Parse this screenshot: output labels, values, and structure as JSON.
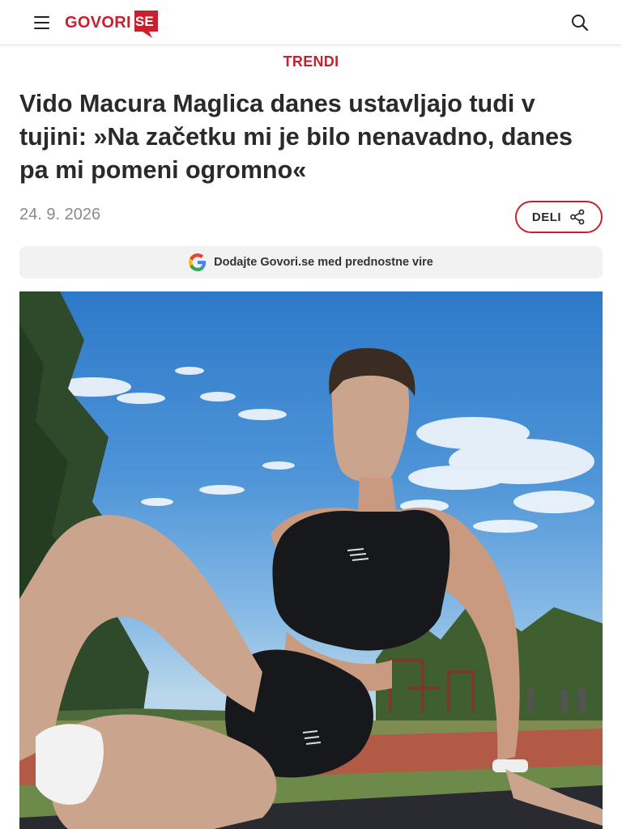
{
  "header": {
    "logo_text": "GOVORI",
    "logo_badge": "SE"
  },
  "article": {
    "category": "TRENDI",
    "title": "Vido Macura Maglica danes ustavljajo tudi v tujini: »Na začetku mi je bilo nenavadno, danes pa mi pomeni ogromno«",
    "date": "24. 9. 2026",
    "share_label": "DELI"
  },
  "google_bar": {
    "text": "Dodajte Govori.se med prednostne vire"
  },
  "colors": {
    "brand": "#c8202e",
    "text": "#2a2a2a",
    "muted": "#8a8a8a",
    "bar_bg": "#f2f2f3"
  },
  "icons": [
    "hamburger-menu-icon",
    "search-icon",
    "share-icon",
    "google-icon"
  ]
}
